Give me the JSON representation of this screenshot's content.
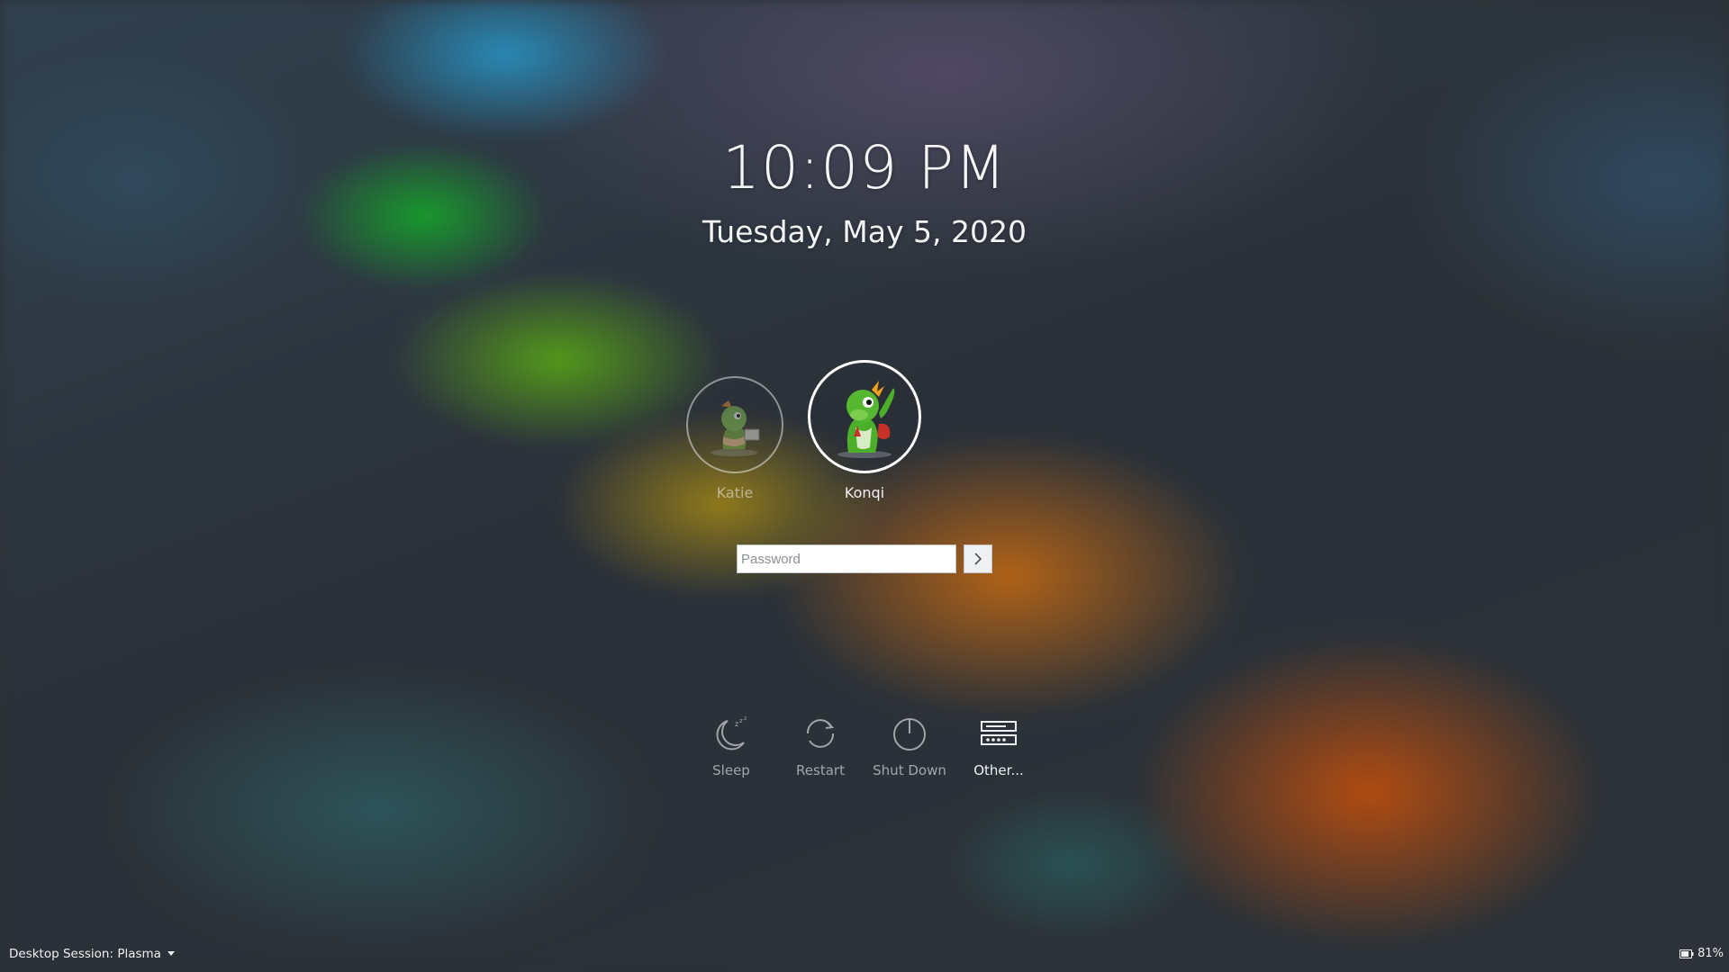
{
  "clock": {
    "time": "10:09 PM",
    "date": "Tuesday, May 5, 2020"
  },
  "users": [
    {
      "name": "Katie",
      "selected": false,
      "avatar_icon": "katie-konqi-avatar-icon"
    },
    {
      "name": "Konqi",
      "selected": true,
      "avatar_icon": "konqi-dragon-avatar-icon"
    }
  ],
  "login": {
    "password_placeholder": "Password",
    "submit_icon": "chevron-right-icon"
  },
  "actions": [
    {
      "label": "Sleep",
      "icon": "sleep-icon"
    },
    {
      "label": "Restart",
      "icon": "restart-icon"
    },
    {
      "label": "Shut Down",
      "icon": "shutdown-icon"
    },
    {
      "label": "Other...",
      "icon": "other-icon"
    }
  ],
  "footer": {
    "session_label": "Desktop Session: Plasma",
    "battery_percent": "81%",
    "battery_level": 0.81
  },
  "colors": {
    "text": "#eff0f1",
    "input_bg": "#ffffff",
    "konqi_green": "#4caf2a",
    "accent_orange": "#c8620e"
  }
}
